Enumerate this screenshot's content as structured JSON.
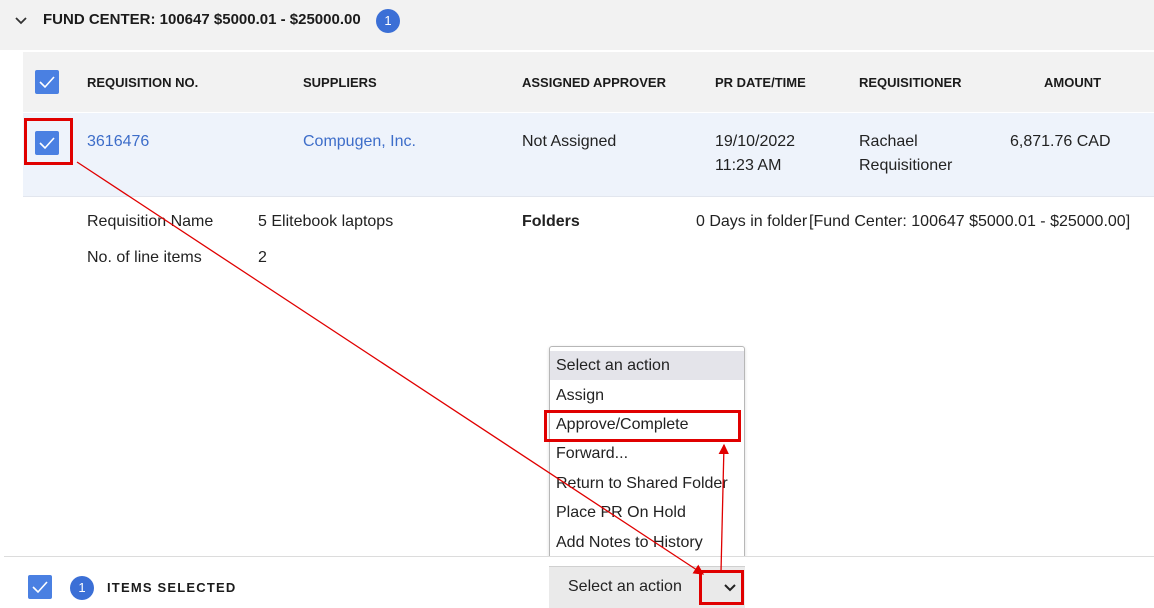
{
  "group": {
    "title": "FUND CENTER: 100647 $5000.01 - $25000.00",
    "count": "1"
  },
  "table": {
    "headers": [
      "REQUISITION NO.",
      "SUPPLIERS",
      "ASSIGNED APPROVER",
      "PR DATE/TIME",
      "REQUISITIONER",
      "AMOUNT"
    ],
    "row": {
      "requisition_no": "3616476",
      "supplier": "Compugen, Inc.",
      "approver": "Not Assigned",
      "date": "19/10/2022",
      "time": "11:23 AM",
      "requisitioner_first": "Rachael",
      "requisitioner_last": "Requisitioner",
      "amount": "6,871.76 CAD"
    }
  },
  "details": {
    "name_label": "Requisition Name",
    "name_value": "5 Elitebook laptops",
    "items_label": "No. of line items",
    "items_value": "2",
    "folders_label": "Folders",
    "days": "0 Days in folder",
    "folder_path": "[Fund Center: 100647 $5000.01 - $25000.00]"
  },
  "dropdown": {
    "options": [
      "Select an action",
      "Assign",
      "Approve/Complete",
      "Forward...",
      "Return to Shared Folder",
      "Place PR On Hold",
      "Add Notes to History"
    ]
  },
  "footer": {
    "count": "1",
    "label": "ITEMS SELECTED",
    "action_label": "Select an action"
  },
  "colors": {
    "accent": "#4a80e2",
    "link": "#3d6dc9",
    "highlight": "#e00000"
  }
}
